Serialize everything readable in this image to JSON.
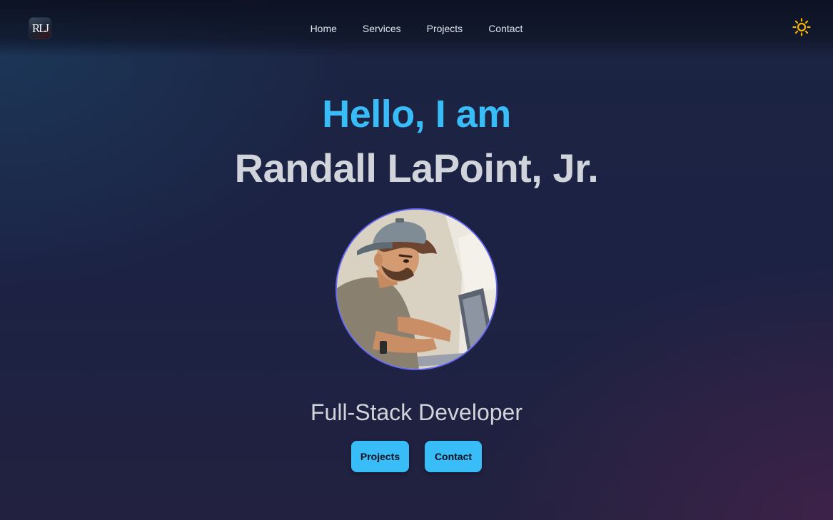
{
  "header": {
    "logo_text": "RLJ",
    "nav": [
      {
        "label": "Home"
      },
      {
        "label": "Services"
      },
      {
        "label": "Projects"
      },
      {
        "label": "Contact"
      }
    ],
    "theme_icon": "sun-icon"
  },
  "hero": {
    "greeting": "Hello, I am",
    "name": "Randall LaPoint, Jr.",
    "avatar_icon": "developer-avatar",
    "role": "Full-Stack Developer",
    "buttons": [
      {
        "label": "Projects"
      },
      {
        "label": "Contact"
      }
    ]
  },
  "colors": {
    "accent": "#38bdf8",
    "heading_gray": "#d1d5db",
    "avatar_border": "#6366f1",
    "sun": "#f5b400"
  }
}
